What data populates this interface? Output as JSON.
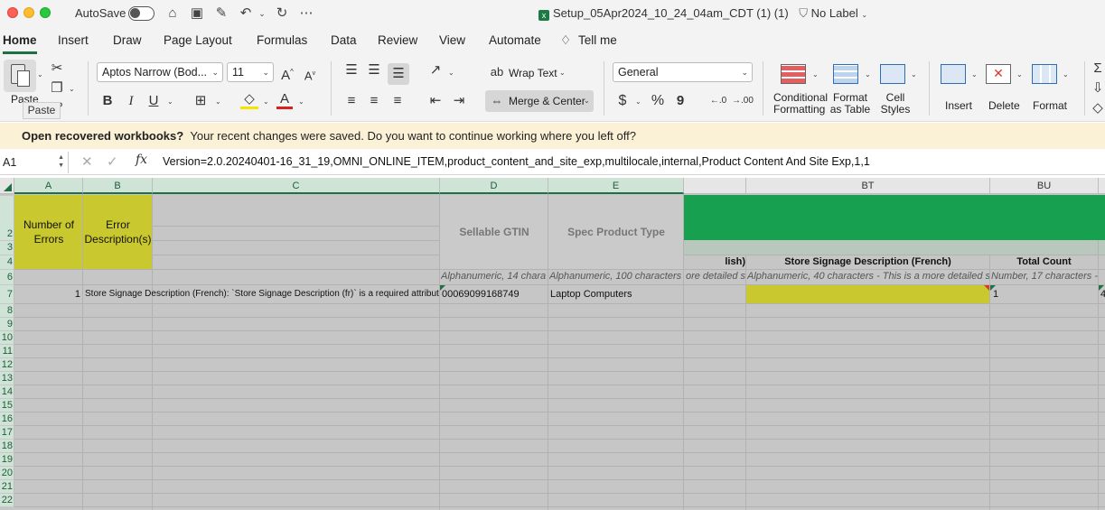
{
  "titlebar": {
    "autosave_label": "AutoSave",
    "document_title": "Setup_05Apr2024_10_24_04am_CDT (1) (1)",
    "label_status": "No Label"
  },
  "tabs": [
    "Home",
    "Insert",
    "Draw",
    "Page Layout",
    "Formulas",
    "Data",
    "Review",
    "View",
    "Automate",
    "Tell me"
  ],
  "ribbon": {
    "paste_label": "Paste",
    "paste_tooltip": "Paste",
    "font_name": "Aptos Narrow (Bod...",
    "font_size": "11",
    "bold": "B",
    "italic": "I",
    "underline": "U",
    "wrap_text": "Wrap Text",
    "merge_center": "Merge & Center",
    "number_format": "General",
    "dollar": "$",
    "percent": "%",
    "comma": "9",
    "conditional_formatting": [
      "Conditional",
      "Formatting"
    ],
    "format_as_table": [
      "Format",
      "as Table"
    ],
    "cell_styles": [
      "Cell",
      "Styles"
    ],
    "insert": "Insert",
    "delete": "Delete",
    "format": "Format"
  },
  "banner": {
    "title": "Open recovered workbooks?",
    "message": "Your recent changes were saved. Do you want to continue working where you left off?"
  },
  "formula_bar": {
    "name_box": "A1",
    "fx": "fx",
    "formula": "Version=2.0.20240401-16_31_19,OMNI_ONLINE_ITEM,product_content_and_site_exp,multilocale,internal,Product Content And Site Exp,1,1"
  },
  "sheet": {
    "columns": [
      "A",
      "B",
      "C",
      "D",
      "E",
      "BT",
      "BU"
    ],
    "rows": [
      "2",
      "3",
      "4",
      "6",
      "7",
      "8",
      "9",
      "10",
      "11",
      "12",
      "13",
      "14",
      "15",
      "16",
      "17",
      "18",
      "19",
      "20",
      "21",
      "22"
    ],
    "headers": {
      "a": "Number of Errors",
      "b": "Error Description(s)",
      "d": "Sellable GTIN",
      "e": "Spec Product Type",
      "bs_partial": "lish)",
      "bt": "Store Signage Description (French)",
      "bu": "Total Count"
    },
    "hints": {
      "d": "Alphanumeric, 14 chara",
      "e": "Alphanumeric, 100 characters",
      "bs": "ore detailed s",
      "bt": "Alphanumeric, 40 characters - This is a more detailed s",
      "bu": "Number, 17 characters -"
    },
    "row7": {
      "a": "1",
      "b": "Store Signage Description (French): `Store Signage Description (fr)` is a required attribute. E",
      "d": "00069099168749",
      "e": "Laptop Computers",
      "bu": "1",
      "edge": "4"
    }
  }
}
